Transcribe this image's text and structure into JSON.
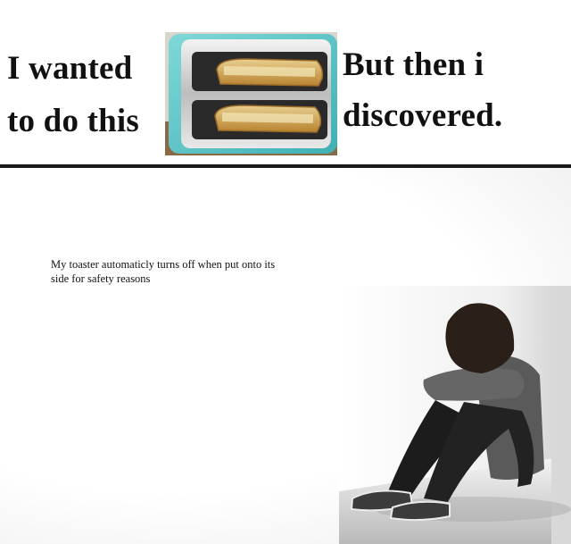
{
  "top_panel": {
    "left_caption_line1": "I wanted",
    "left_caption_line2": "to do this",
    "right_caption_line1": "But then i",
    "right_caption_line2": "discovered."
  },
  "bottom_panel": {
    "note_text": "My toaster automaticly turns off when put onto its side for safety reasons"
  },
  "colors": {
    "toaster_body": "#5ec7c9",
    "divider": "#1a1a1a",
    "hoodie": "#5a5a5a"
  }
}
